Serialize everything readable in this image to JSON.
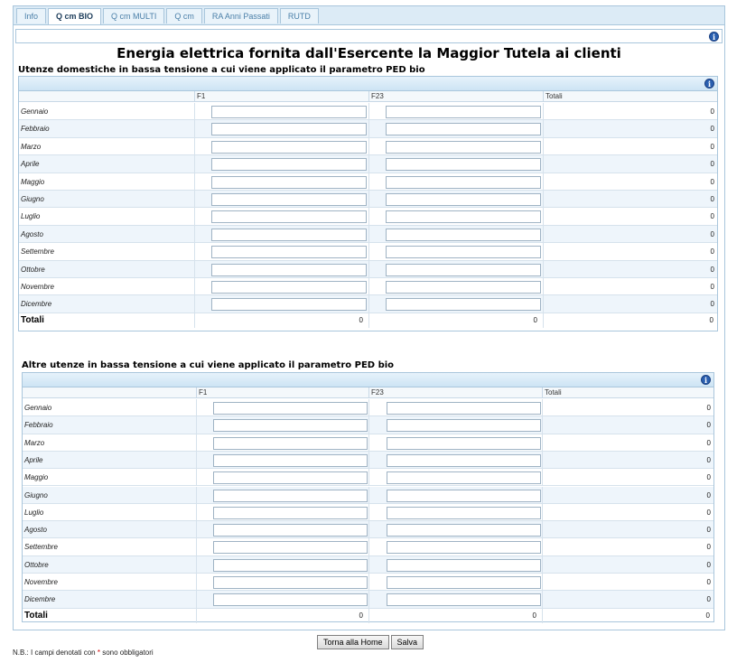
{
  "tabs": [
    "Info",
    "Q cm BIO",
    "Q cm MULTI",
    "Q cm",
    "RA Anni Passati",
    "RUTD"
  ],
  "active_tab_index": 1,
  "main_title": "Energia elettrica fornita dall'Esercente la Maggior Tutela ai clienti",
  "info_icon_glyph": "i",
  "section1": {
    "title": "Utenze domestiche in bassa tensione a cui viene applicato il parametro PED bio",
    "columns": [
      "F1",
      "F23",
      "Totali"
    ],
    "months": [
      "Gennaio",
      "Febbraio",
      "Marzo",
      "Aprile",
      "Maggio",
      "Giugno",
      "Luglio",
      "Agosto",
      "Settembre",
      "Ottobre",
      "Novembre",
      "Dicembre"
    ],
    "row_totals": [
      "0",
      "0",
      "0",
      "0",
      "0",
      "0",
      "0",
      "0",
      "0",
      "0",
      "0",
      "0"
    ],
    "f1_values": [
      "",
      "",
      "",
      "",
      "",
      "",
      "",
      "",
      "",
      "",
      "",
      ""
    ],
    "f23_values": [
      "",
      "",
      "",
      "",
      "",
      "",
      "",
      "",
      "",
      "",
      "",
      ""
    ],
    "totals_label": "Totali",
    "totals": {
      "f1": "0",
      "f23": "0",
      "all": "0"
    }
  },
  "section2": {
    "title": "Altre utenze in bassa tensione a cui viene applicato il parametro PED bio",
    "columns": [
      "F1",
      "F23",
      "Totali"
    ],
    "months": [
      "Gennaio",
      "Febbraio",
      "Marzo",
      "Aprile",
      "Maggio",
      "Giugno",
      "Luglio",
      "Agosto",
      "Settembre",
      "Ottobre",
      "Novembre",
      "Dicembre"
    ],
    "row_totals": [
      "0",
      "0",
      "0",
      "0",
      "0",
      "0",
      "0",
      "0",
      "0",
      "0",
      "0",
      "0"
    ],
    "f1_values": [
      "",
      "",
      "",
      "",
      "",
      "",
      "",
      "",
      "",
      "",
      "",
      ""
    ],
    "f23_values": [
      "",
      "",
      "",
      "",
      "",
      "",
      "",
      "",
      "",
      "",
      "",
      ""
    ],
    "totals_label": "Totali",
    "totals": {
      "f1": "0",
      "f23": "0",
      "all": "0"
    }
  },
  "buttons": {
    "home": "Torna alla Home",
    "save": "Salva"
  },
  "note": {
    "before": "N.B.: I campi denotati con",
    "star": "*",
    "after": "sono obbligatori"
  },
  "colors": {
    "accent": "#4a7fa8",
    "header_bg": "#cde4f4",
    "alt_row": "#eef5fb",
    "required": "#d00000"
  }
}
